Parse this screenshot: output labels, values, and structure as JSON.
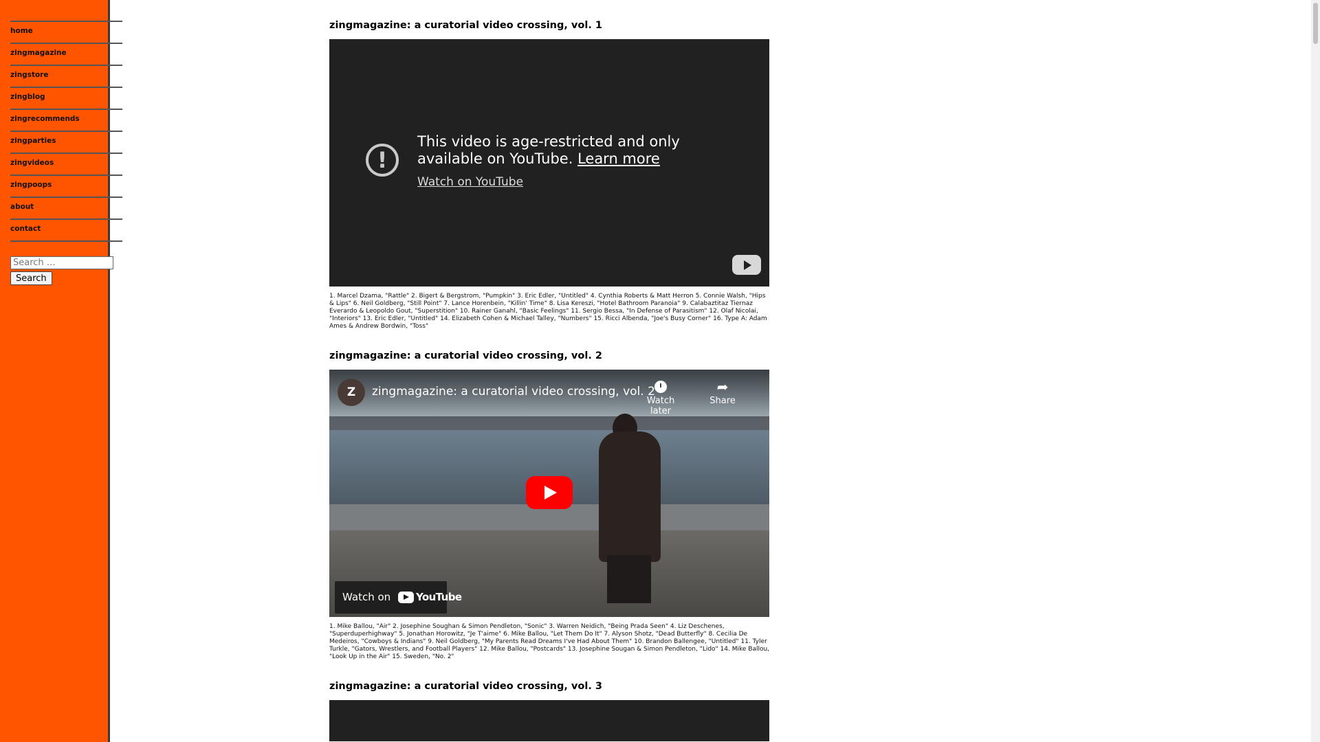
{
  "colors": {
    "sidebar_bg": "#ff5500",
    "video_bg": "#212121",
    "play_button": "#ff0000"
  },
  "nav": {
    "items": [
      {
        "label": "home"
      },
      {
        "label": "zingmagazine"
      },
      {
        "label": "zingstore"
      },
      {
        "label": "zingblog"
      },
      {
        "label": "zingrecommends"
      },
      {
        "label": "zingparties"
      },
      {
        "label": "zingvideos"
      },
      {
        "label": "zingpoops"
      },
      {
        "label": "about"
      },
      {
        "label": "contact"
      }
    ]
  },
  "search": {
    "placeholder": "Search …",
    "button_label": "Search"
  },
  "posts": [
    {
      "title": "zingmagazine: a curatorial video crossing, vol. 1",
      "video": {
        "restricted_message": "This video is age-restricted and only available on YouTube.",
        "learn_more": "Learn more",
        "watch_link": "Watch on YouTube",
        "alert_icon": "!"
      },
      "caption": "1. Marcel Dzama, \"Rattle\" 2. Bigert & Bergstrom, \"Pumpkin\" 3. Eric Edler, \"Untitled\" 4. Cynthia Roberts & Matt Herron 5. Connie Walsh, \"Hips & Lips\" 6. Neil Goldberg, \"Still Point\" 7. Lance Horenbein, \"Killin' Time\" 8. Lisa Kereszi, \"Hotel Bathroom Paranoia\" 9. Calabaztitaz Tiernaz Everardo & Leopoldo Gout, \"Superstition\" 10. Rainer Ganahl, \"Basic Feelings\" 11. Sergio Bessa, \"In Defense of Parasitism\" 12. Olaf Nicolai, \"Interiors\" 13. Eric Edler, \"Untitled\" 14. Elizabeth Cohen & Michael Talley, \"Numbers\" 15. Ricci Albenda, \"Joe's Busy Corner\" 16. Type A: Adam Ames & Andrew Bordwin, \"Toss\""
    },
    {
      "title": "zingmagazine: a curatorial video crossing, vol. 2",
      "video": {
        "channel_initial": "Z",
        "title": "zingmagazine: a curatorial video crossing, vol. 2",
        "watch_later": "Watch later",
        "share": "Share",
        "watch_on": "Watch on",
        "youtube": "YouTube"
      },
      "caption": "1. Mike Ballou, \"Air\" 2. Josephine Soughan & Simon Pendleton, \"Sonic\" 3. Warren Neidich, \"Being Prada Seen\" 4. Liz Deschenes, \"Superduperhighway\" 5. Jonathan Horowitz, \"Je T'aime\" 6. Mike Ballou, \"Let Them Do It\" 7. Alyson Shotz, \"Dead Butterfly\" 8. Cecilia De Medeiros, \"Cowboys & Indians\" 9. Neil Goldberg, \"My Parents Read Dreams I've Had About Them\" 10. Brandon Ballengee, \"Untitled\" 11. Tyler Turkle, \"Gators, Wrestlers, and Football Players\" 12. Mike Ballou, \"Postcards\" 13. Josephine Sougan & Simon Pendleton, \"Lido\" 14. Mike Ballou, \"Look Up in the Air\" 15. Sweden, \"No. 2\""
    },
    {
      "title": "zingmagazine: a curatorial video crossing, vol. 3"
    }
  ]
}
